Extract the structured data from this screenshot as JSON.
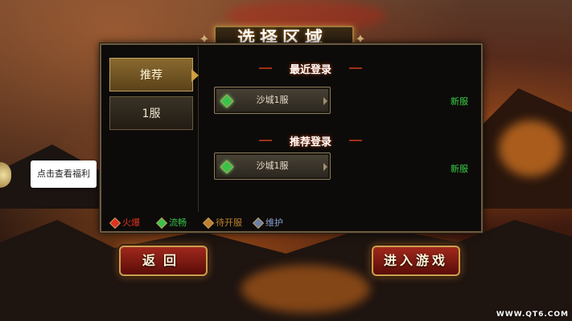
{
  "title": "选择区域",
  "tabs": [
    {
      "label": "推荐",
      "active": true
    },
    {
      "label": "1服",
      "active": false
    }
  ],
  "sections": [
    {
      "title": "最近登录",
      "server": "沙城1服",
      "tag": "新服"
    },
    {
      "title": "推荐登录",
      "server": "沙城1服",
      "tag": "新服"
    }
  ],
  "legend": [
    {
      "label": "火爆",
      "color": "#e03020"
    },
    {
      "label": "流畅",
      "color": "#39c24a"
    },
    {
      "label": "待开服",
      "color": "#c08030"
    },
    {
      "label": "维护",
      "color": "#6a80a8"
    }
  ],
  "tooltip": "点击查看福利",
  "buttons": {
    "back": "返回",
    "enter": "进入游戏"
  },
  "watermark": "WWW.QT6.COM",
  "colors": {
    "accent": "#c8a050",
    "tag_green": "#38d048"
  }
}
